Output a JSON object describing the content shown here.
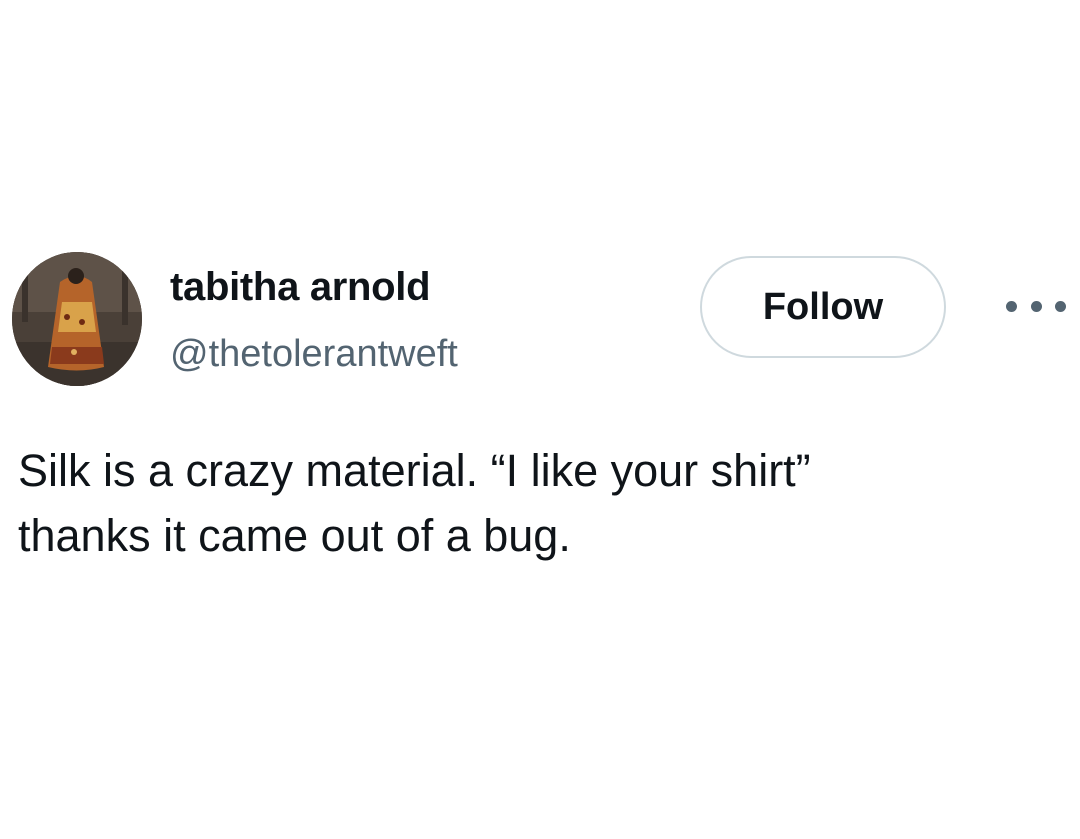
{
  "tweet": {
    "author": {
      "display_name": "tabitha arnold",
      "handle": "@thetolerantweft"
    },
    "follow_label": "Follow",
    "more_icon": "more-horizontal-icon",
    "text_lines": [
      "Silk is a crazy material. “I like your shirt”",
      "thanks it came out of a bug."
    ]
  },
  "colors": {
    "text_primary": "#0f1419",
    "text_secondary": "#536471",
    "border": "#cfd9de",
    "background": "#ffffff"
  }
}
